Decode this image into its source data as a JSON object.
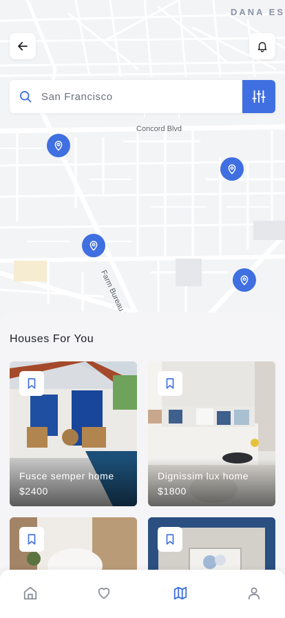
{
  "map": {
    "district_label": "DANA ES",
    "street_labels": {
      "concord": "Concord Blvd",
      "farm_bureau": "Farm Bureau Rd"
    }
  },
  "search": {
    "placeholder": "San Francisco",
    "value": ""
  },
  "section": {
    "title": "Houses For You"
  },
  "houses": [
    {
      "name": "Fusce semper home",
      "price": "$2400"
    },
    {
      "name": "Dignissim lux home",
      "price": "$1800"
    }
  ],
  "colors": {
    "accent": "#3f6fe0",
    "nav_active": "#3f6fe0",
    "nav_inactive": "#8a8f99"
  },
  "nav": {
    "items": [
      {
        "icon": "home-icon",
        "active": false
      },
      {
        "icon": "heart-icon",
        "active": false
      },
      {
        "icon": "map-icon",
        "active": true
      },
      {
        "icon": "user-icon",
        "active": false
      }
    ]
  }
}
